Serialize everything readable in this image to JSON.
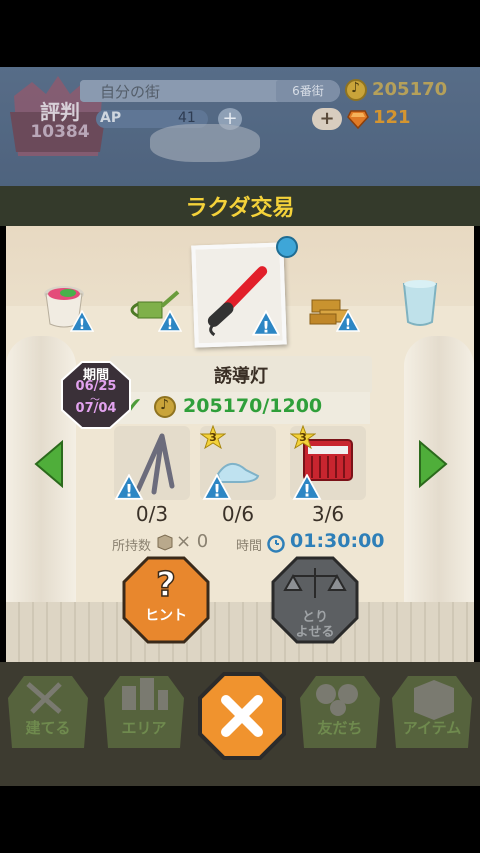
{
  "hud": {
    "reputation_label": "評判",
    "reputation_value": "10384",
    "town_name": "自分の街",
    "town_tag": "6番街",
    "coins": "205170",
    "ap_label": "AP",
    "ap_value": "41",
    "ap_plus": "+",
    "gem_plus": "+",
    "gems": "121"
  },
  "modal": {
    "title": "ラクダ交易",
    "item_name": "誘導灯",
    "period_label": "期間",
    "period_start": "06/25",
    "period_end": "07/04",
    "price": "205170/1200",
    "materials": [
      {
        "count": "0/3",
        "stars": ""
      },
      {
        "count": "0/6",
        "stars": "3"
      },
      {
        "count": "3/6",
        "stars": "3"
      }
    ],
    "owned_label": "所持数",
    "owned_value": "× 0",
    "time_label": "時間",
    "time_value": "01:30:00",
    "hint_label": "ヒント",
    "trade_label_1": "とり",
    "trade_label_2": "よせる"
  },
  "nav": {
    "build": "建てる",
    "area": "エリア",
    "friends": "友だち",
    "items": "アイテム"
  },
  "colors": {
    "title_yellow": "#f4d23a",
    "price_green": "#2f9f3a",
    "timer_blue": "#2e7fb8",
    "hint_orange": "#e8872d",
    "close_orange": "#f0932e",
    "period_pink": "#e2a2ef",
    "arrow_green": "#4fae3a"
  },
  "icons": {
    "reputation": "crown-icon",
    "coin": "coin-icon",
    "gem": "gem-icon",
    "warning": "warning-icon",
    "check": "check-icon",
    "star": "star-icon",
    "timer": "timer-icon",
    "box": "box-icon",
    "hint": "question-icon",
    "trade": "scale-icon",
    "close": "close-icon"
  }
}
